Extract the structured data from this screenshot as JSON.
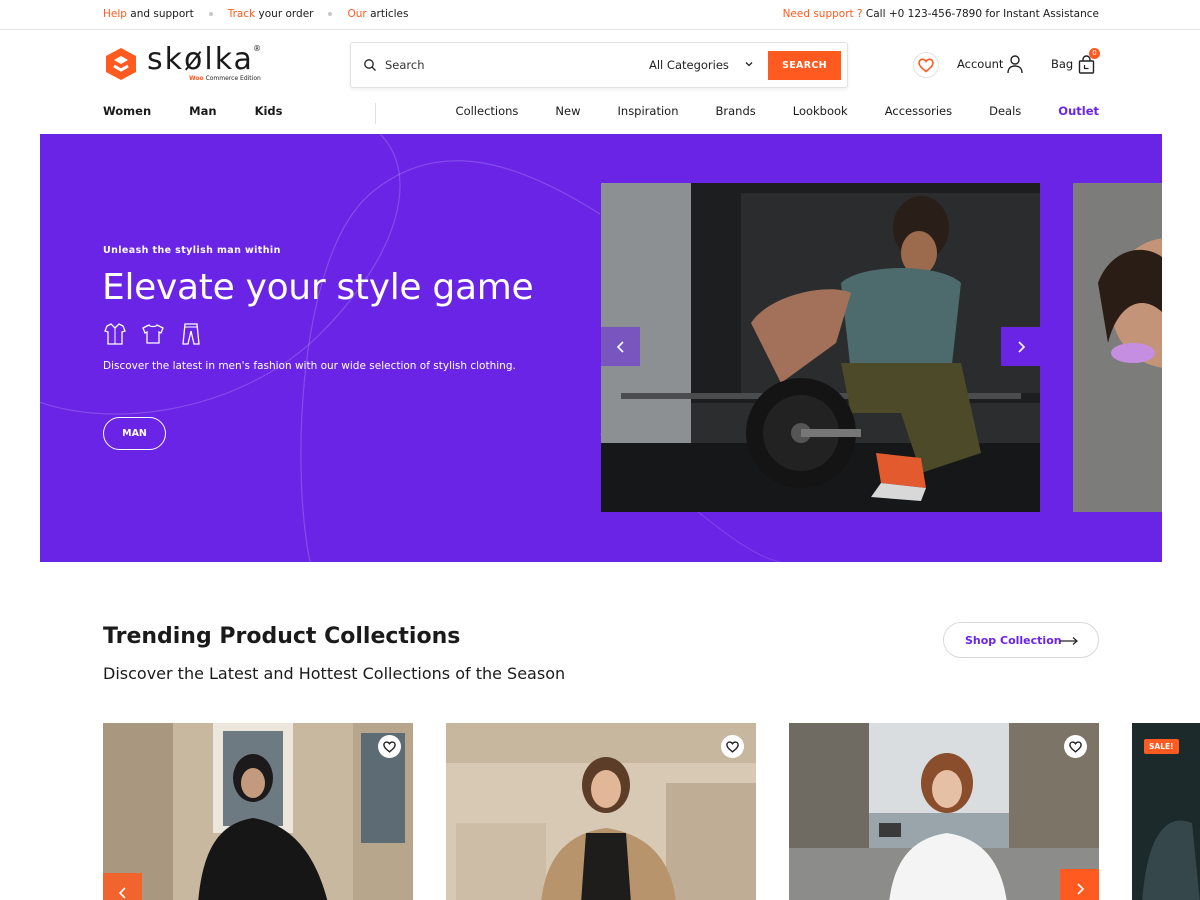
{
  "topbar": {
    "help_accent": "Help",
    "help_rest": " and support",
    "track_accent": "Track",
    "track_rest": " your order",
    "articles_accent": "Our",
    "articles_rest": " articles",
    "support_accent": "Need support ? ",
    "support_rest": "Call +0 123-456-7890 for Instant Assistance"
  },
  "brand": {
    "name": "skølka",
    "registered": "®",
    "edition_accent": "Woo",
    "edition_rest": " Commerce Edition",
    "accent_color": "#ff5a1f",
    "primary_color": "#6a24e6"
  },
  "search": {
    "placeholder": "Search",
    "category": "All Categories",
    "button": "SEARCH"
  },
  "header": {
    "account_label": "Account",
    "bag_label": "Bag",
    "bag_count": "0"
  },
  "nav": {
    "left": [
      "Women",
      "Man",
      "Kids"
    ],
    "right": [
      "Collections",
      "New",
      "Inspiration",
      "Brands",
      "Lookbook",
      "Accessories",
      "Deals"
    ],
    "outlet": "Outlet"
  },
  "hero": {
    "kicker": "Unleash the stylish man within",
    "headline": "Elevate your style game",
    "icons": [
      "shirt-icon",
      "tshirt-icon",
      "trousers-icon"
    ],
    "description": "Discover the latest in men's fashion with our wide selection of stylish clothing.",
    "cta": "MAN"
  },
  "trending": {
    "title": "Trending Product Collections",
    "subtitle": "Discover the Latest and Hottest Collections of the Season",
    "button": "Shop Collection",
    "sale_badge": "SALE!"
  }
}
